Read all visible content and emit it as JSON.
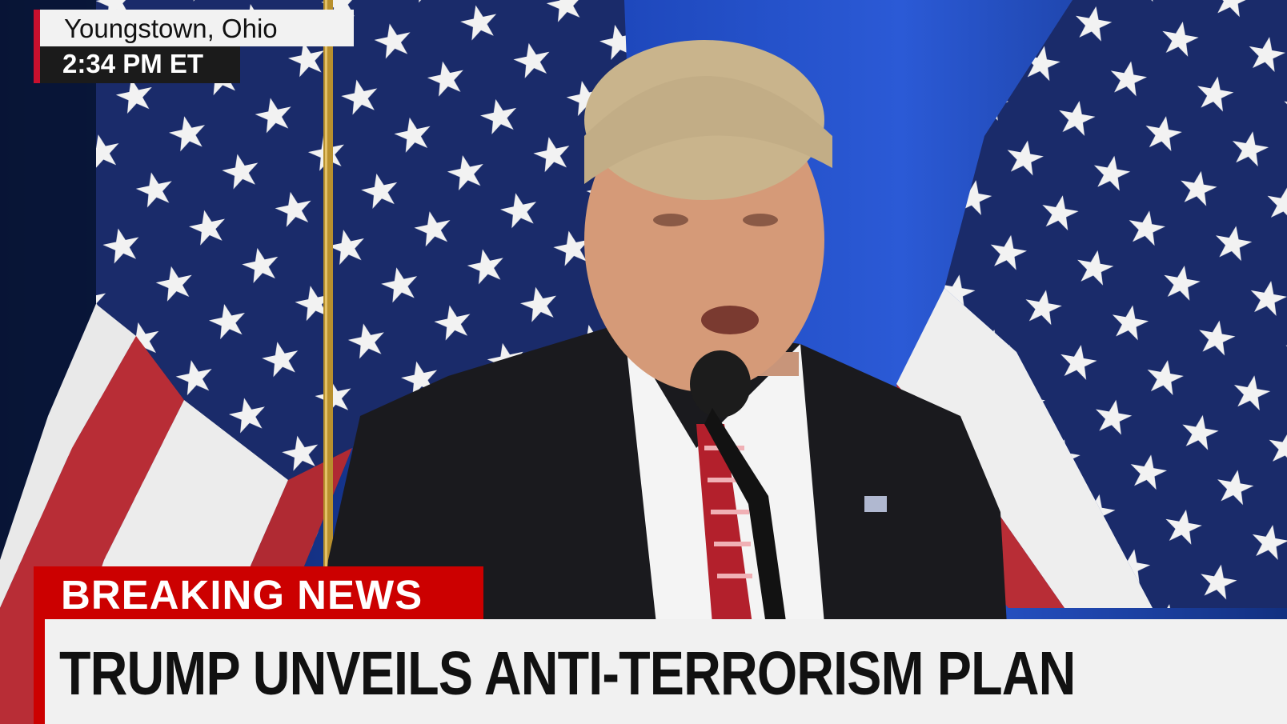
{
  "location": {
    "city": "Youngstown, Ohio",
    "time": "2:34 PM ET"
  },
  "breaking_label": "BREAKING NEWS",
  "headline": "TRUMP UNVEILS ANTI-TERRORISM PLAN",
  "colors": {
    "accent_red": "#cc0000",
    "bar_light": "#f1f1f1",
    "backdrop_blue": "#1b3f9e"
  }
}
